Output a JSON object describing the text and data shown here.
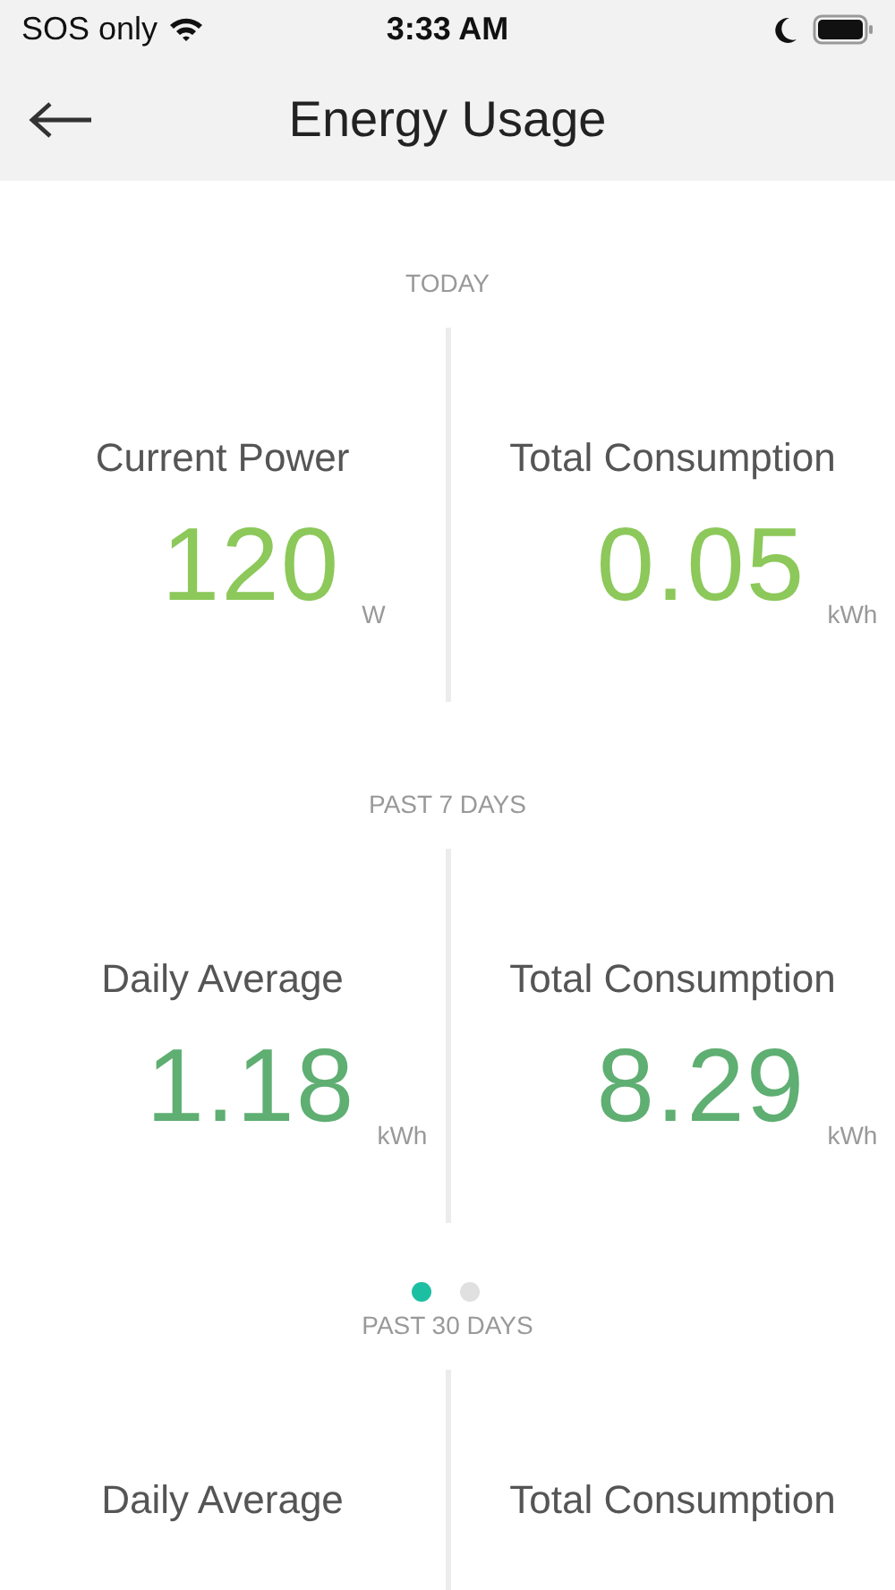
{
  "status_bar": {
    "carrier": "SOS only",
    "time": "3:33 AM"
  },
  "nav": {
    "title": "Energy Usage"
  },
  "sections": [
    {
      "label": "TODAY",
      "color": "#8cc85a",
      "stats": [
        {
          "title": "Current Power",
          "value": "120",
          "unit": "W"
        },
        {
          "title": "Total Consumption",
          "value": "0.05",
          "unit": "kWh"
        }
      ]
    },
    {
      "label": "PAST 7 DAYS",
      "color": "#5fae72",
      "stats": [
        {
          "title": "Daily Average",
          "value": "1.18",
          "unit": "kWh"
        },
        {
          "title": "Total Consumption",
          "value": "8.29",
          "unit": "kWh"
        }
      ]
    },
    {
      "label": "PAST 30 DAYS",
      "stats": [
        {
          "title": "Daily Average"
        },
        {
          "title": "Total Consumption"
        }
      ]
    }
  ],
  "page_dots": [
    {
      "selected": true
    },
    {
      "selected": false
    }
  ]
}
